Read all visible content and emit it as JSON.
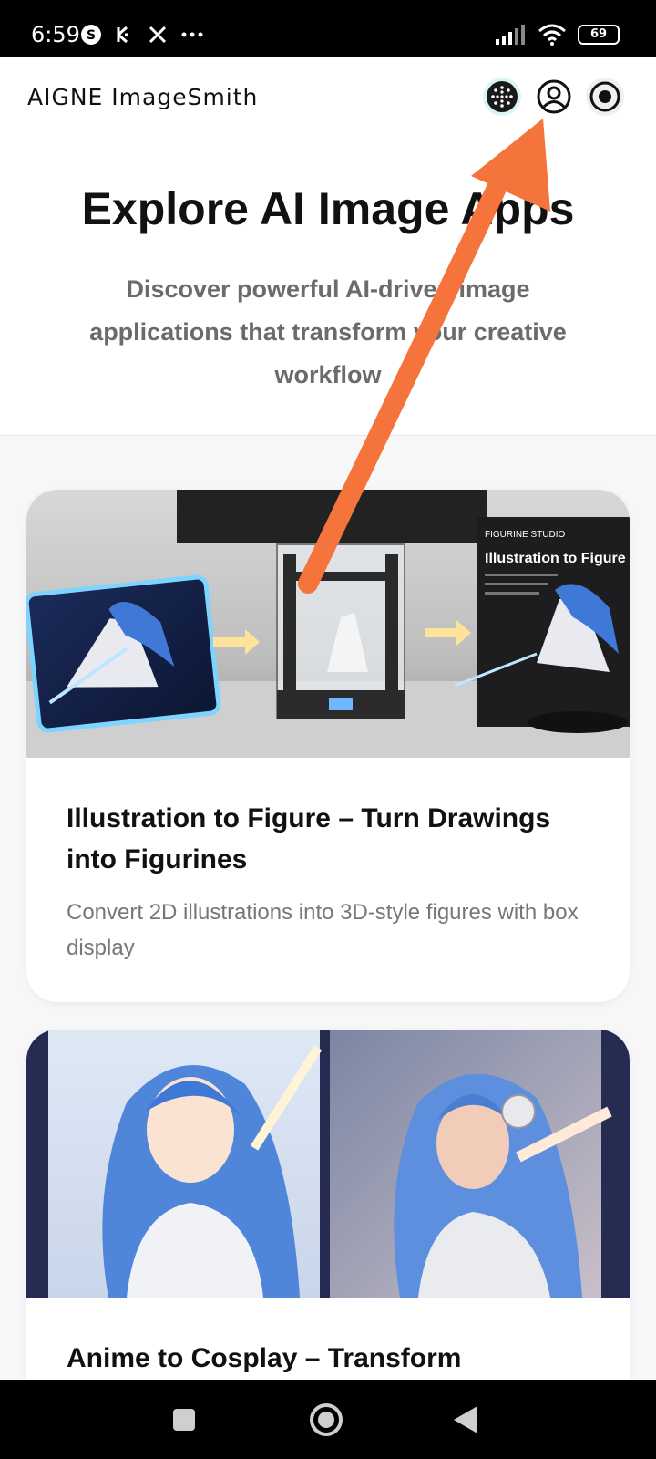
{
  "status_bar": {
    "time": "6:59",
    "battery": "69",
    "icons_left": [
      "s-app-icon",
      "kucoin-icon",
      "x-icon",
      "more-dots-icon"
    ],
    "icons_right": [
      "signal-icon",
      "wifi-icon",
      "battery-icon"
    ]
  },
  "header": {
    "app_name": "AIGNE ImageSmith",
    "buttons": [
      "aigne-logo-icon",
      "user-account-icon",
      "record-icon"
    ]
  },
  "hero": {
    "title": "Explore AI Image Apps",
    "subtitle": "Discover powerful AI-driven image applications that transform your creative workflow"
  },
  "cards": [
    {
      "title": "Illustration to Figure – Turn Drawings into Figurines",
      "description": "Convert 2D illustrations into 3D-style figures with box display",
      "image_text": {
        "brand": "FIGURINE STUDIO",
        "box_title": "Illustration to Figure"
      }
    },
    {
      "title": "Anime to Cosplay – Transform"
    }
  ],
  "colors": {
    "annotation_arrow": "#f4743b",
    "accent_blue": "#3f78d6"
  }
}
